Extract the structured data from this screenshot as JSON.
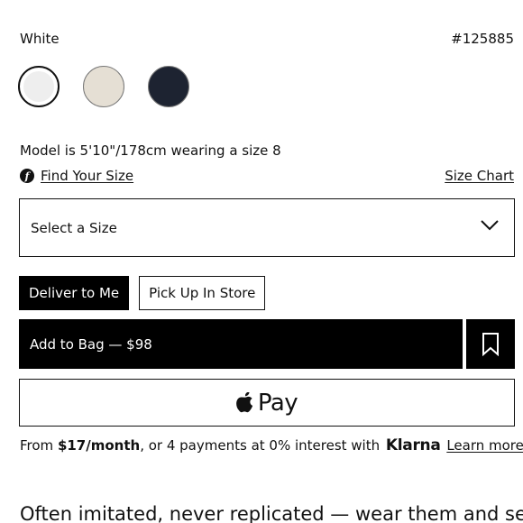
{
  "product": {
    "color_name": "White",
    "sku": "#125885",
    "swatches": [
      {
        "name": "white",
        "color": "#eeeeee",
        "selected": true
      },
      {
        "name": "cream",
        "color": "#e5dfd4",
        "selected": false
      },
      {
        "name": "navy",
        "color": "#1d2331",
        "selected": false
      }
    ],
    "model_info": "Model is 5'10\"/178cm wearing a size 8"
  },
  "size": {
    "find_your_size": "Find Your Size",
    "find_icon": "fit-finder-icon",
    "size_chart": "Size Chart",
    "select_placeholder": "Select a Size"
  },
  "delivery": {
    "deliver_label": "Deliver to Me",
    "pickup_label": "Pick Up In Store"
  },
  "purchase": {
    "add_to_bag": "Add to Bag — $98",
    "wishlist_icon": "bookmark-icon",
    "apple_pay_word": "Pay"
  },
  "klarna": {
    "prefix": "From ",
    "monthly": "$17/month",
    "middle": ", or 4 payments at 0% interest with ",
    "brand": "Klarna",
    "learn_more": "Learn more"
  },
  "description": {
    "tagline": "Often imitated, never replicated — wear them and see"
  },
  "colors": {
    "black": "#000000",
    "border": "#111111"
  }
}
